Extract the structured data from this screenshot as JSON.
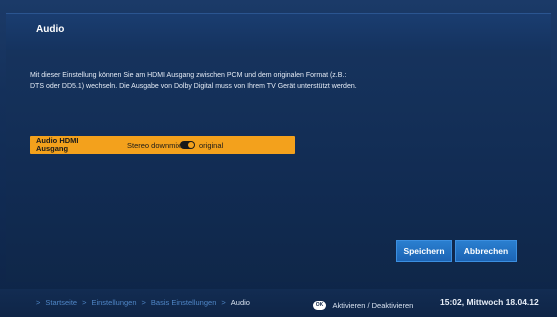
{
  "header": {
    "title": "Audio"
  },
  "description": {
    "line1": "Mit dieser Einstellung können Sie am HDMI Ausgang zwischen PCM und dem originalen Format (z.B.:",
    "line2": "DTS oder DD5.1) wechseln. Die Ausgabe von Dolby Digital muss von Ihrem TV Gerät unterstützt werden."
  },
  "setting": {
    "label_line1": "Audio HDMI",
    "label_line2": "Ausgang",
    "option_left": "Stereo downmix",
    "option_right": "original",
    "selected": "original"
  },
  "buttons": {
    "save": "Speichern",
    "cancel": "Abbrechen"
  },
  "footer": {
    "breadcrumb": [
      "Startseite",
      "Einstellungen",
      "Basis Einstellungen",
      "Audio"
    ],
    "separator": ">",
    "ok_key": "OK",
    "ok_label": "Aktivieren / Deaktivieren",
    "clock": "15:02, Mittwoch 18.04.12"
  },
  "colors": {
    "highlight": "#f3a11c",
    "button": "#1c64b4",
    "breadcrumb_link": "#4f86c6"
  }
}
